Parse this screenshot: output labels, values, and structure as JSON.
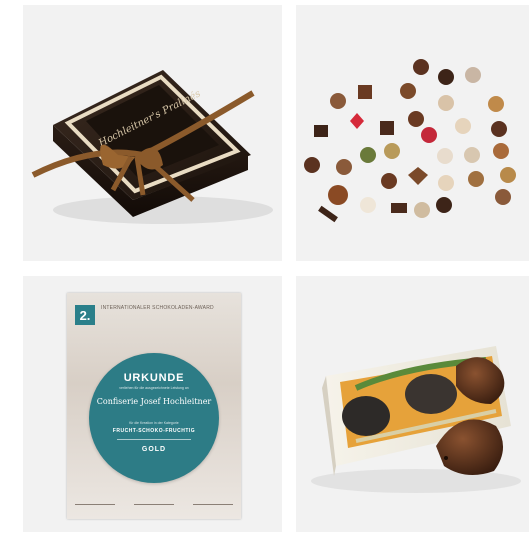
{
  "products": [
    {
      "name": "Pralinen Geschenkbox",
      "box_text": "Hochleitner's Pralinés"
    },
    {
      "name": "Pralinen Sortiment"
    },
    {
      "name": "Urkunde"
    },
    {
      "name": "Schokoladen Igel"
    }
  ],
  "certificate": {
    "rank": "2.",
    "header": "INTERNATIONALER SCHOKOLADEN-AWARD",
    "title": "URKUNDE",
    "subtitle": "verliehen für die ausgezeichnete Leistung an",
    "recipient": "Confiserie Josef Hochleitner",
    "category_intro": "für die Kreation in der Kategorie",
    "category": "FRUCHT-SCHOKO-FRUCHTIG",
    "award": "GOLD"
  },
  "colors": {
    "tile_bg": "#f2f2f2",
    "box_dark": "#2b1e16",
    "ribbon": "#8b5a2b",
    "cert_teal": "#2d7c86"
  }
}
